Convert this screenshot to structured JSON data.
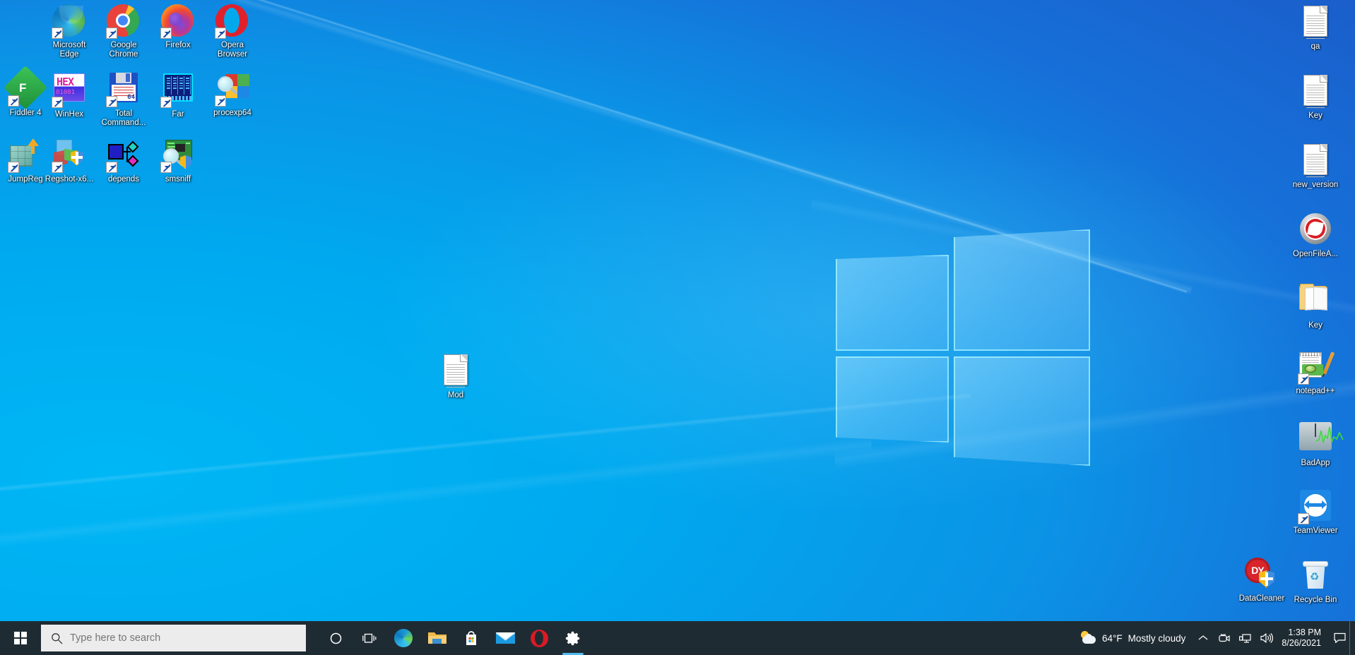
{
  "desktop": {
    "wallpaper_name": "windows-10-hero-blue",
    "colors": {
      "wallpaper_left": "#00AEEF",
      "wallpaper_right": "#1A5FCC",
      "taskbar": "#1F2B33",
      "search_box": "#ECECEC",
      "accent_underline": "#53B9F0"
    },
    "left_icons": [
      {
        "label": "Microsoft Edge",
        "icon": "edge-icon",
        "shortcut": true
      },
      {
        "label": "Google Chrome",
        "icon": "chrome-icon",
        "shortcut": true
      },
      {
        "label": "Firefox",
        "icon": "firefox-icon",
        "shortcut": true
      },
      {
        "label": "Opera Browser",
        "icon": "opera-icon",
        "shortcut": true
      },
      {
        "label": "Fiddler 4",
        "icon": "fiddler-icon",
        "shortcut": true
      },
      {
        "label": "WinHex",
        "icon": "winhex-icon",
        "shortcut": true
      },
      {
        "label": "Total Command...",
        "icon": "total-commander-icon",
        "shortcut": true
      },
      {
        "label": "Far",
        "icon": "far-manager-icon",
        "shortcut": true
      },
      {
        "label": "procexp64",
        "icon": "process-explorer-icon",
        "shortcut": true
      },
      {
        "label": "JumpReg",
        "icon": "jumpreg-icon",
        "shortcut": true
      },
      {
        "label": "Regshot-x6...",
        "icon": "regshot-icon",
        "shortcut": true
      },
      {
        "label": "depends",
        "icon": "dependency-walker-icon",
        "shortcut": true
      },
      {
        "label": "smsniff",
        "icon": "smsniff-icon",
        "shortcut": true
      }
    ],
    "center_icons": [
      {
        "label": "Mod",
        "icon": "text-document-icon",
        "shortcut": false
      }
    ],
    "right_icons": [
      {
        "label": "qa",
        "icon": "text-document-icon",
        "shortcut": false
      },
      {
        "label": "Key",
        "icon": "text-document-icon",
        "shortcut": false
      },
      {
        "label": "new_version",
        "icon": "text-document-icon",
        "shortcut": false
      },
      {
        "label": "OpenFileA...",
        "icon": "openfilesview-icon",
        "shortcut": false
      },
      {
        "label": "Key",
        "icon": "folder-icon",
        "shortcut": false
      },
      {
        "label": "notepad++",
        "icon": "notepadpp-icon",
        "shortcut": true
      },
      {
        "label": "BadApp",
        "icon": "badapp-icon",
        "shortcut": false
      },
      {
        "label": "TeamViewer",
        "icon": "teamviewer-icon",
        "shortcut": true
      },
      {
        "label": "DataCleaner",
        "icon": "datacleaner-icon",
        "shortcut": false
      },
      {
        "label": "Recycle Bin",
        "icon": "recycle-bin-icon",
        "shortcut": false
      }
    ]
  },
  "taskbar": {
    "start_label": "Start",
    "search": {
      "placeholder": "Type here to search",
      "value": ""
    },
    "buttons": [
      {
        "name": "cortana-button",
        "icon": "cortana-circle-icon",
        "label": "Cortana",
        "active": false
      },
      {
        "name": "task-view-button",
        "icon": "task-view-icon",
        "label": "Task View",
        "active": false
      },
      {
        "name": "edge-taskbar-button",
        "icon": "edge-icon",
        "label": "Microsoft Edge",
        "active": false
      },
      {
        "name": "file-explorer-button",
        "icon": "file-explorer-icon",
        "label": "File Explorer",
        "active": false
      },
      {
        "name": "microsoft-store-button",
        "icon": "microsoft-store-icon",
        "label": "Microsoft Store",
        "active": false
      },
      {
        "name": "mail-button",
        "icon": "mail-icon",
        "label": "Mail",
        "active": false
      },
      {
        "name": "opera-taskbar-button",
        "icon": "opera-icon",
        "label": "Opera Browser",
        "active": false
      },
      {
        "name": "settings-button",
        "icon": "gear-icon",
        "label": "Settings",
        "active": true
      }
    ],
    "tray": {
      "weather": {
        "icon": "partly-cloudy-icon",
        "temperature": "64°F",
        "condition": "Mostly cloudy"
      },
      "overflow_label": "Show hidden icons",
      "icons": [
        {
          "name": "show-hidden-icons-chevron",
          "icon": "chevron-up-icon"
        },
        {
          "name": "meet-now-icon",
          "icon": "meet-now-camera-icon"
        },
        {
          "name": "network-icon",
          "icon": "network-monitor-icon"
        },
        {
          "name": "volume-icon",
          "icon": "speaker-icon"
        }
      ],
      "clock": {
        "time": "1:38 PM",
        "date": "8/26/2021"
      },
      "action_center": {
        "name": "action-center-button",
        "icon": "speech-bubble-icon"
      },
      "show_desktop": {
        "name": "show-desktop-button"
      }
    }
  }
}
